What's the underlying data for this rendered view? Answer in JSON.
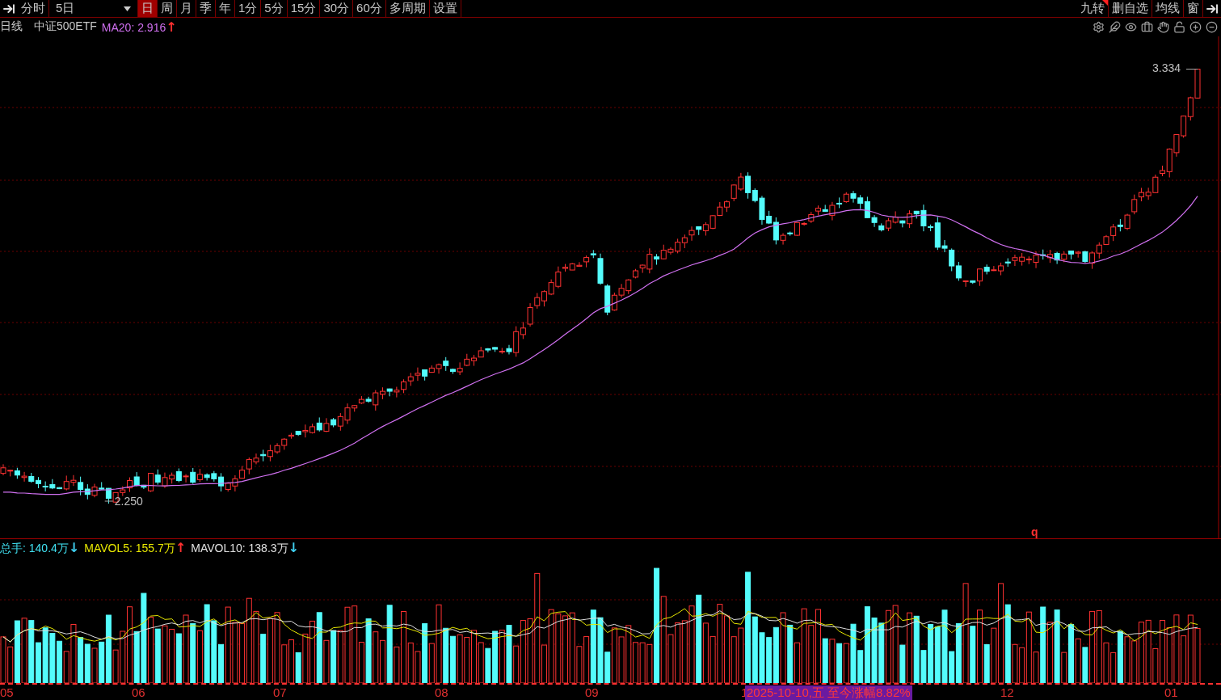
{
  "toolbar": {
    "periods": [
      {
        "label": "分时",
        "selected": false,
        "kind": "tab"
      },
      {
        "label": "5日",
        "selected": false,
        "kind": "dropdown"
      },
      {
        "label": "日",
        "selected": true,
        "kind": "tab"
      },
      {
        "label": "周",
        "selected": false,
        "kind": "tab"
      },
      {
        "label": "月",
        "selected": false,
        "kind": "tab"
      },
      {
        "label": "季",
        "selected": false,
        "kind": "tab"
      },
      {
        "label": "年",
        "selected": false,
        "kind": "tab"
      },
      {
        "label": "1分",
        "selected": false,
        "kind": "tab"
      },
      {
        "label": "5分",
        "selected": false,
        "kind": "tab"
      },
      {
        "label": "15分",
        "selected": false,
        "kind": "tab"
      },
      {
        "label": "30分",
        "selected": false,
        "kind": "tab"
      },
      {
        "label": "60分",
        "selected": false,
        "kind": "tab"
      },
      {
        "label": "多周期",
        "selected": false,
        "kind": "tab"
      },
      {
        "label": "设置",
        "selected": false,
        "kind": "tab"
      }
    ],
    "actions": [
      {
        "label": "九转",
        "flagged": true
      },
      {
        "label": "删自选",
        "flagged": false
      },
      {
        "label": "均线",
        "flagged": false
      },
      {
        "label": "窗",
        "flagged": false
      }
    ]
  },
  "price_legend": {
    "period": "日线",
    "name": "中证500ETF",
    "items": [
      {
        "label": "MA20: 2.916",
        "color": "#d070f0",
        "arrow": {
          "label": "↑",
          "color": "#ff3030"
        }
      }
    ]
  },
  "price_chart": {
    "max_label": "3.334",
    "min_label": "2.250",
    "marker": "q"
  },
  "volume_legend": {
    "items": [
      {
        "label": "总手: 140.4万",
        "color": "#40e0f0",
        "arrow": {
          "label": "↓",
          "color": "#40d0f0"
        }
      },
      {
        "label": "MAVOL5: 155.7万",
        "color": "#e8e800",
        "arrow": {
          "label": "↑",
          "color": "#ff3030"
        }
      },
      {
        "label": "MAVOL10: 138.3万",
        "color": "#e0e0e0",
        "arrow": {
          "label": "↓",
          "color": "#40d0f0"
        }
      }
    ]
  },
  "x_axis": {
    "labels": [
      "05",
      "06",
      "07",
      "08",
      "09",
      "1",
      "12",
      "01"
    ],
    "tooltip": "2025-10-10,五 至今涨幅8.82%"
  }
}
